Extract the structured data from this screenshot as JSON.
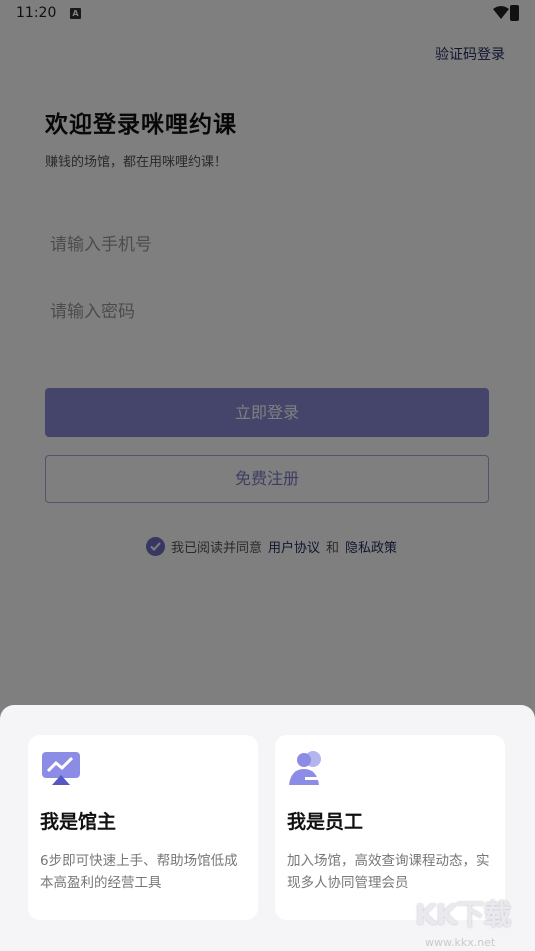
{
  "status_bar": {
    "time": "11:20",
    "notification_icon": "A"
  },
  "header": {
    "sms_login": "验证码登录"
  },
  "welcome": {
    "title": "欢迎登录咪哩约课",
    "subtitle": "赚钱的场馆，都在用咪哩约课！"
  },
  "form": {
    "phone_placeholder": "请输入手机号",
    "password_placeholder": "请输入密码",
    "login_label": "立即登录",
    "register_label": "免费注册",
    "agreement_prefix": "我已阅读并同意",
    "user_agreement": "用户协议",
    "and": "和",
    "privacy_policy": "隐私政策"
  },
  "role_sheet": {
    "owner": {
      "title": "我是馆主",
      "description": "6步即可快速上手、帮助场馆低成本高盈利的经营工具"
    },
    "staff": {
      "title": "我是员工",
      "description": "加入场馆，高效查询课程动态，实现多人协同管理会员"
    }
  },
  "watermark": {
    "text": "KK下载",
    "url": "www.kkx.net"
  },
  "colors": {
    "accent": "#8a8ad6",
    "link": "#1f2d5c",
    "overlay": "rgba(0,0,0,0.5)"
  }
}
